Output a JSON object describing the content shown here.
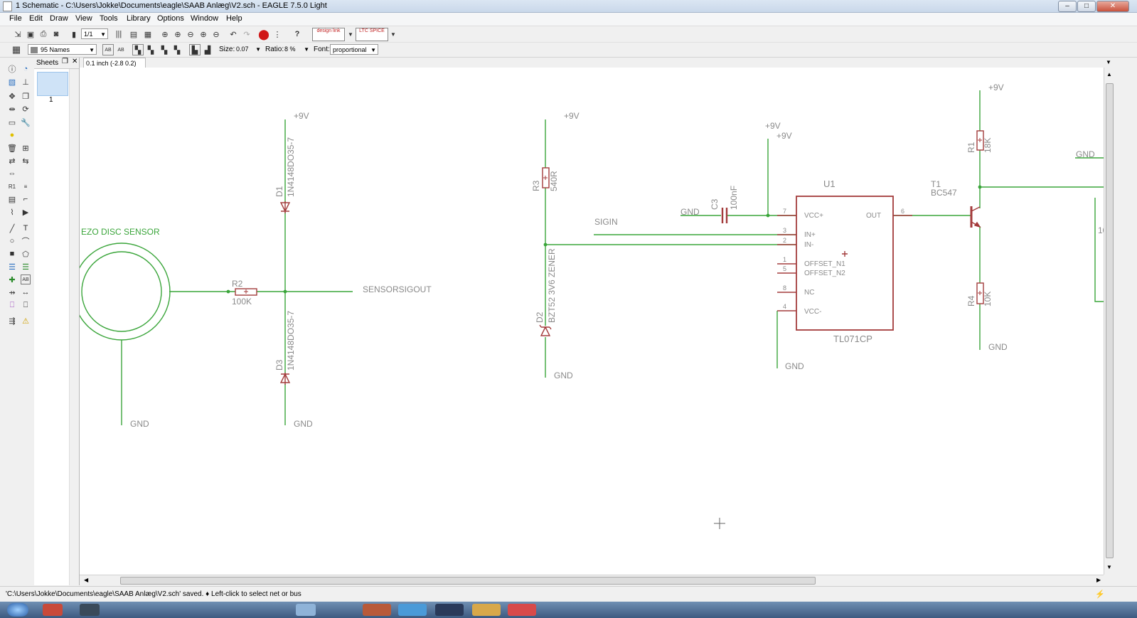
{
  "window": {
    "title": "1 Schematic - C:\\Users\\Jokke\\Documents\\eagle\\SAAB Anlæg\\V2.sch - EAGLE 7.5.0 Light",
    "minimize": "–",
    "maximize": "□",
    "close": "✕"
  },
  "menu": [
    "File",
    "Edit",
    "Draw",
    "View",
    "Tools",
    "Library",
    "Options",
    "Window",
    "Help"
  ],
  "toolbar": {
    "sheet_select": "1/1",
    "design_link": "design link",
    "ltspice": "LTC SPICE"
  },
  "paramsbar": {
    "layer": "95 Names",
    "size_label": "Size:",
    "size_value": "0.07",
    "ratio_label": "Ratio:",
    "ratio_value": "8 %",
    "font_label": "Font:",
    "font_value": "proportional"
  },
  "sheets": {
    "header": "Sheets",
    "sheet_number": "1"
  },
  "coords": "0.1 inch (-2.8 0.2)",
  "status": "'C:\\Users\\Jokke\\Documents\\eagle\\SAAB Anlæg\\V2.sch' saved.  ♦ Left-click to select net or bus",
  "schematic": {
    "net_color": "#3aa53a",
    "part_color": "#a33b3b",
    "label_color": "#8a8a8a",
    "labels": {
      "sensor": "EZO DISC SENSOR",
      "r2_name": "R2",
      "r2_value": "100K",
      "sensorsigout": "SENSORSIGOUT",
      "d1_name": "D1",
      "d1_value": "1N4148DO35-7",
      "d3_name": "D3",
      "d3_value": "1N4148DO35-7",
      "r3_name": "R3",
      "r3_value": "540R",
      "d2_name": "D2",
      "d2_value": "BZT52 3V6 ZENER",
      "sigin": "SIGIN",
      "c3_name": "C3",
      "c3_value": "100nF",
      "u1_name": "U1",
      "u1_value": "TL071CP",
      "vcc_plus": "VCC+",
      "in_plus": "IN+",
      "in_minus": "IN-",
      "offset_n1": "OFFSET_N1",
      "offset_n2": "OFFSET_N2",
      "nc": "NC",
      "vcc_minus": "VCC-",
      "out": "OUT",
      "pin7": "7",
      "pin3": "3",
      "pin2": "2",
      "pin1": "1",
      "pin5": "5",
      "pin8": "8",
      "pin4": "4",
      "pin6": "6",
      "r1_name": "R1",
      "r1_value": "18K",
      "r4_name": "R4",
      "r4_value": "10K",
      "t1_name": "T1",
      "t1_value": "BC547",
      "v9": "+9V",
      "gnd": "GND",
      "partial_10": "10"
    }
  }
}
